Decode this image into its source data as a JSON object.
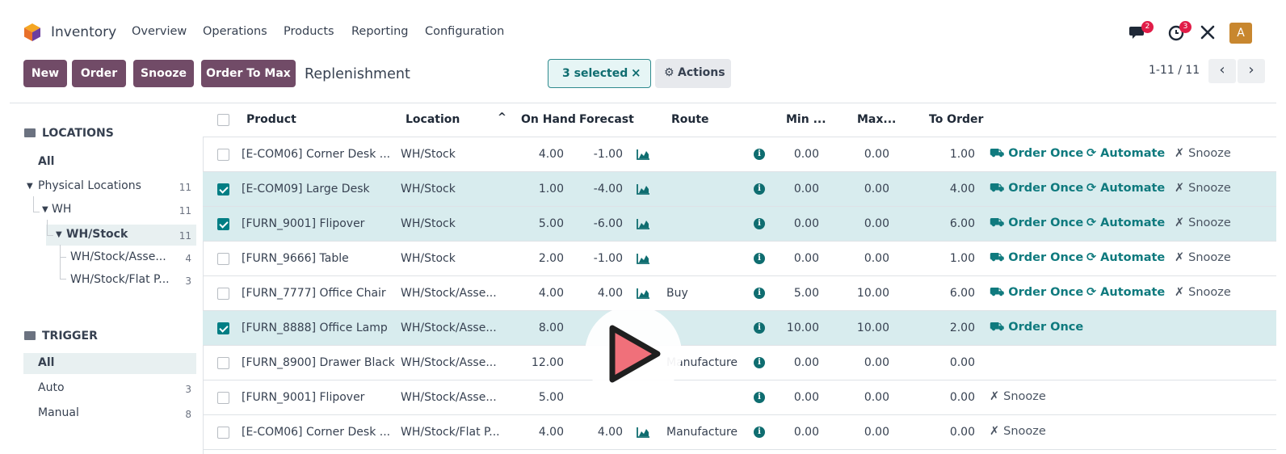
{
  "app": {
    "name": "Inventory",
    "brand_color": "#714b67",
    "accent_color": "#017e84"
  },
  "nav": {
    "menus": [
      "Overview",
      "Operations",
      "Products",
      "Reporting",
      "Configuration"
    ]
  },
  "systray": {
    "messages_badge": "2",
    "activity_badge": "3",
    "avatar_initial": "A"
  },
  "toolbar": {
    "buttons": [
      "New",
      "Order",
      "Snooze",
      "Order To Max"
    ],
    "title": "Replenishment",
    "selected_label": "3 selected",
    "selected_clear": "×",
    "actions_label": "Actions",
    "pager": "1-11 / 11"
  },
  "sidebar": {
    "locations_title": "LOCATIONS",
    "locations": [
      {
        "label": "All",
        "count": ""
      },
      {
        "label": "Physical Locations",
        "count": "11"
      },
      {
        "label": "WH",
        "count": "11"
      },
      {
        "label": "WH/Stock",
        "count": "11"
      },
      {
        "label": "WH/Stock/Asse...",
        "count": "4"
      },
      {
        "label": "WH/Stock/Flat P...",
        "count": "3"
      }
    ],
    "trigger_title": "TRIGGER",
    "triggers": [
      {
        "label": "All",
        "count": ""
      },
      {
        "label": "Auto",
        "count": "3"
      },
      {
        "label": "Manual",
        "count": "8"
      }
    ]
  },
  "table": {
    "headers": [
      "Product",
      "Location",
      "On Hand",
      "Forecast",
      "Route",
      "Min ...",
      "Max...",
      "To Order"
    ],
    "action_labels": {
      "order_once": "Order Once",
      "automate": "Automate",
      "snooze": "Snooze"
    },
    "rows": [
      {
        "product": "[E-COM06] Corner Desk ...",
        "location": "WH/Stock",
        "on_hand": "4.00",
        "forecast": "-1.00",
        "route": "",
        "min": "0.00",
        "max": "0.00",
        "to_order": "1.00",
        "selected": false,
        "actions": [
          "order_once",
          "automate",
          "snooze"
        ]
      },
      {
        "product": "[E-COM09] Large Desk",
        "location": "WH/Stock",
        "on_hand": "1.00",
        "forecast": "-4.00",
        "route": "",
        "min": "0.00",
        "max": "0.00",
        "to_order": "4.00",
        "selected": true,
        "actions": [
          "order_once",
          "automate",
          "snooze"
        ]
      },
      {
        "product": "[FURN_9001] Flipover",
        "location": "WH/Stock",
        "on_hand": "5.00",
        "forecast": "-6.00",
        "route": "",
        "min": "0.00",
        "max": "0.00",
        "to_order": "6.00",
        "selected": true,
        "actions": [
          "order_once",
          "automate",
          "snooze"
        ]
      },
      {
        "product": "[FURN_9666] Table",
        "location": "WH/Stock",
        "on_hand": "2.00",
        "forecast": "-1.00",
        "route": "",
        "min": "0.00",
        "max": "0.00",
        "to_order": "1.00",
        "selected": false,
        "actions": [
          "order_once",
          "automate",
          "snooze"
        ]
      },
      {
        "product": "[FURN_7777] Office Chair",
        "location": "WH/Stock/Asse...",
        "on_hand": "4.00",
        "forecast": "4.00",
        "route": "Buy",
        "min": "5.00",
        "max": "10.00",
        "to_order": "6.00",
        "selected": false,
        "actions": [
          "order_once",
          "automate",
          "snooze"
        ]
      },
      {
        "product": "[FURN_8888] Office Lamp",
        "location": "WH/Stock/Asse...",
        "on_hand": "8.00",
        "forecast": "",
        "route": "",
        "min": "10.00",
        "max": "10.00",
        "to_order": "2.00",
        "selected": true,
        "actions": [
          "order_once"
        ]
      },
      {
        "product": "[FURN_8900] Drawer Black",
        "location": "WH/Stock/Asse...",
        "on_hand": "12.00",
        "forecast": "",
        "route": "Manufacture",
        "min": "0.00",
        "max": "0.00",
        "to_order": "0.00",
        "selected": false,
        "actions": []
      },
      {
        "product": "[FURN_9001] Flipover",
        "location": "WH/Stock/Asse...",
        "on_hand": "5.00",
        "forecast": "",
        "route": "",
        "min": "0.00",
        "max": "0.00",
        "to_order": "0.00",
        "selected": false,
        "actions": [
          "snooze"
        ]
      },
      {
        "product": "[E-COM06] Corner Desk ...",
        "location": "WH/Stock/Flat P...",
        "on_hand": "4.00",
        "forecast": "4.00",
        "route": "Manufacture",
        "min": "0.00",
        "max": "0.00",
        "to_order": "0.00",
        "selected": false,
        "actions": [
          "snooze"
        ]
      }
    ]
  }
}
